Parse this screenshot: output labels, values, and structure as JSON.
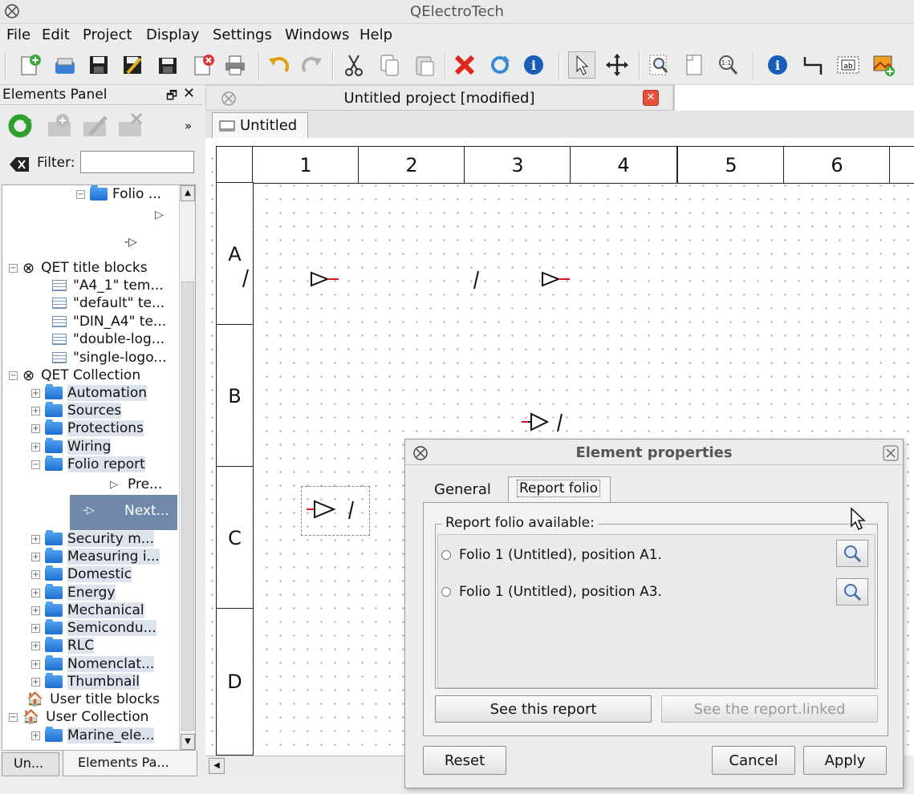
{
  "window": {
    "title": "QElectroTech"
  },
  "menu": [
    "File",
    "Edit",
    "Project",
    "Display",
    "Settings",
    "Windows",
    "Help"
  ],
  "toolbar": {
    "icons": [
      "new-project-icon",
      "open-icon",
      "save-icon",
      "save-as-icon",
      "save-all-icon",
      "close-project-icon",
      "print-icon",
      "undo-icon",
      "redo-icon",
      "cut-icon",
      "copy-icon",
      "paste-icon",
      "delete-icon",
      "rotate-icon",
      "info-icon",
      "select-pointer-icon",
      "move-icon",
      "zoom-fit-icon",
      "zoom-page-icon",
      "zoom-reset-icon",
      "properties-icon",
      "add-conductor-icon",
      "add-text-icon",
      "add-image-icon"
    ]
  },
  "elements_panel": {
    "title": "Elements Panel",
    "filter_label": "Filter:",
    "filter_value": "",
    "tree": {
      "folio_partial": "Folio ...",
      "title_blocks_group": "QET title blocks",
      "title_blocks": [
        "\"A4_1\" tem...",
        "\"default\" te...",
        "\"DIN_A4\" te...",
        "\"double-log...",
        "\"single-logo..."
      ],
      "collection_group": "QET Collection",
      "categories_top": [
        "Automation",
        "Sources",
        "Protections",
        "Wiring",
        "Folio report"
      ],
      "folio_report_items": [
        "Pre...",
        "Next..."
      ],
      "categories_bottom": [
        "Security m...",
        "Measuring i...",
        "Domestic",
        "Energy",
        "Mechanical",
        "Semicondu...",
        "RLC",
        "Nomenclat...",
        "Thumbnail"
      ],
      "user_title_blocks": "User title blocks",
      "user_collection": "User Collection",
      "user_collection_items": [
        "Marine_ele..."
      ]
    },
    "bottom_tabs": [
      "Un...",
      "Elements Pa..."
    ]
  },
  "project": {
    "title": "Untitled project [modified]",
    "folio_tab": "Untitled",
    "columns": [
      "1",
      "2",
      "3",
      "4",
      "5",
      "6"
    ],
    "rows": [
      "A",
      "B",
      "C",
      "D"
    ]
  },
  "dialog": {
    "title": "Element properties",
    "tabs": [
      "General",
      "Report folio"
    ],
    "active_tab": "Report folio",
    "group_label": "Report folio available:",
    "options": [
      "Folio  1 (Untitled), position A1.",
      "Folio  1 (Untitled), position A3."
    ],
    "see_report": "See this report",
    "see_linked": "See the report.linked",
    "reset": "Reset",
    "cancel": "Cancel",
    "apply": "Apply"
  },
  "colors": {
    "selection": "#7089aa",
    "accent_red": "#e8402a",
    "folder_blue": "#2f82df"
  }
}
